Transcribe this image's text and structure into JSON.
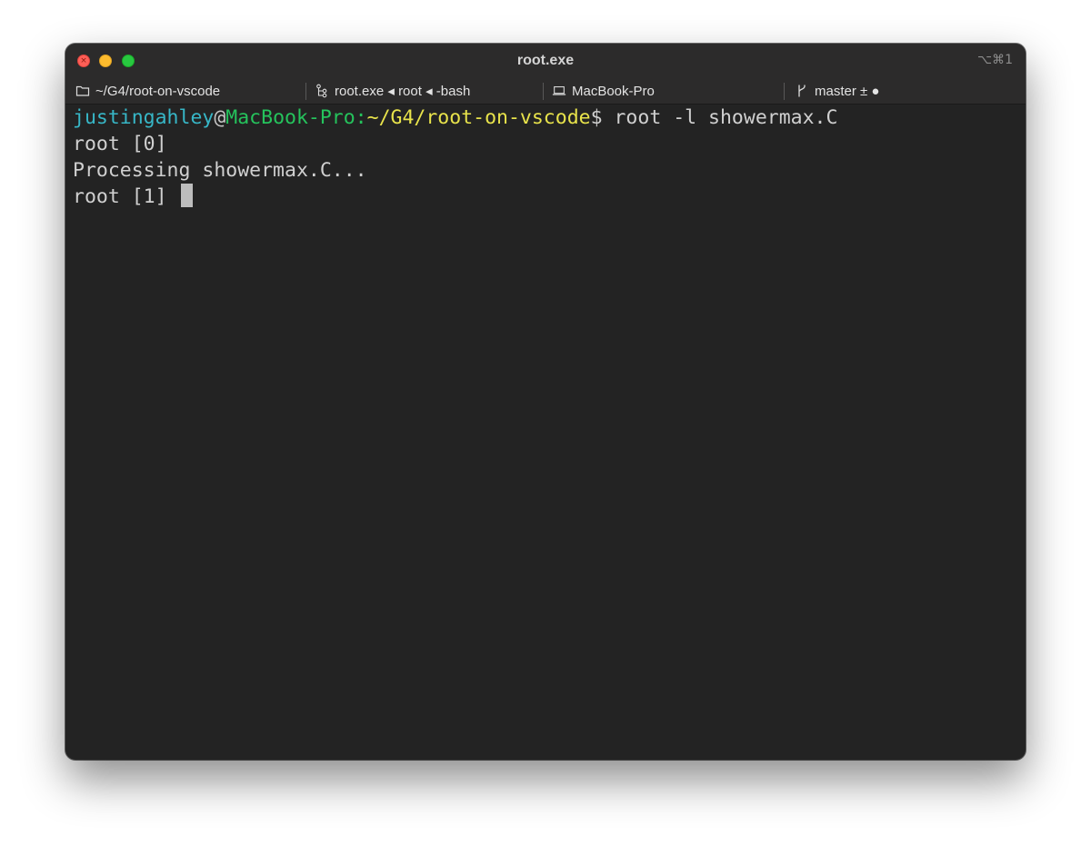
{
  "window": {
    "title": "root.exe",
    "shortcut": "⌥⌘1"
  },
  "statusbar": {
    "directory": {
      "icon": "folder-icon",
      "label": "~/G4/root-on-vscode"
    },
    "process": {
      "icon": "process-tree-icon",
      "label": "root.exe ◂ root ◂ -bash"
    },
    "host": {
      "icon": "laptop-icon",
      "label": "MacBook-Pro"
    },
    "git": {
      "icon": "git-branch-icon",
      "label": "master ± ●"
    }
  },
  "terminal": {
    "prompt": {
      "user": "justingahley",
      "at": "@",
      "host": "MacBook-Pro:",
      "path": "~/G4/root-on-vscode",
      "symbol": "$ ",
      "command": "root -l showermax.C"
    },
    "lines": [
      "root [0]",
      "Processing showermax.C...",
      "root [1] "
    ]
  },
  "colors": {
    "background": "#232323",
    "titlebar": "#2c2b2b",
    "user": "#37b7c7",
    "host": "#25c35c",
    "path": "#e8e34b",
    "text": "#d0d0d0"
  }
}
